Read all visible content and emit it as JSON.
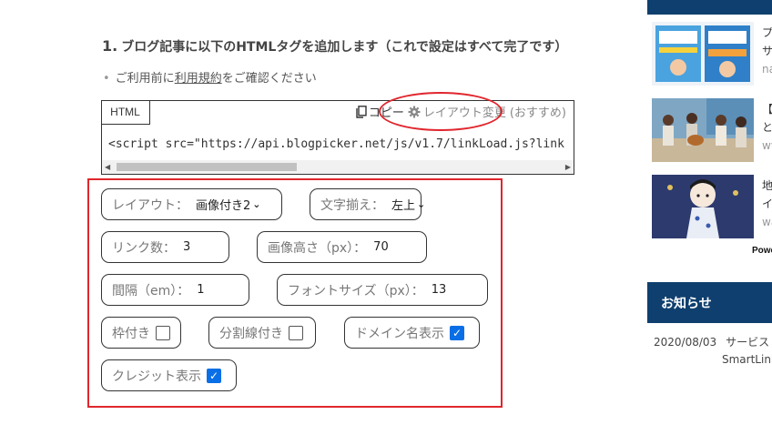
{
  "step": {
    "number": "1.",
    "title": "ブログ記事に以下のHTMLタグを追加します（これで設定はすべて完了です）"
  },
  "note": {
    "prefix": "ご利用前に",
    "link": "利用規約",
    "suffix": "をご確認ください"
  },
  "code_box": {
    "tab_label": "HTML",
    "copy_label": "コピー",
    "layout_label": "レイアウト変更",
    "recommend_label": "(おすすめ)",
    "code": "<script src=\"https://api.blogpicker.net/js/v1.7/linkLoad.js?link"
  },
  "settings": {
    "layout_label": "レイアウト：",
    "layout_value": "画像付き2",
    "align_label": "文字揃え：",
    "align_value": "左上",
    "link_count_label": "リンク数：",
    "link_count_value": "3",
    "image_height_label": "画像高さ（px）：",
    "image_height_value": "70",
    "spacing_label": "間隔（em）：",
    "spacing_value": "1",
    "font_size_label": "フォントサイズ（px）：",
    "font_size_value": "13",
    "border_label": "枠付き",
    "border_checked": false,
    "divider_label": "分割線付き",
    "divider_checked": false,
    "domain_label": "ドメイン名表示",
    "domain_checked": true,
    "credit_label": "クレジット表示",
    "credit_checked": true
  },
  "sidebar": {
    "items": [
      {
        "title_char": "プ",
        "line2": "サ",
        "sub": "na"
      },
      {
        "title_char": "【",
        "line2": "と",
        "sub": "wv"
      },
      {
        "title_char": "地",
        "line2": "イ",
        "sub": "wa"
      }
    ],
    "powered": "Powe",
    "news_heading": "お知らせ",
    "news_date": "2020/08/03",
    "news_title": "サービス",
    "news_title2": "SmartLink"
  },
  "colors": {
    "accent_red": "#e0262d",
    "sidebar_navy": "#0f3f6e",
    "checkbox_blue": "#0a6fe6"
  }
}
